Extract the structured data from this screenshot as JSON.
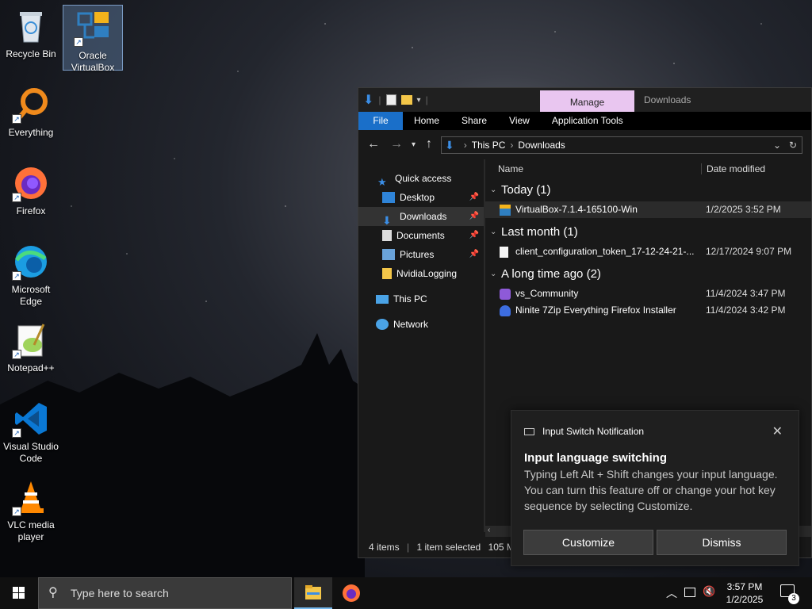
{
  "desktop": {
    "icons": [
      {
        "label": "Recycle Bin",
        "icon": "recycle-bin-icon"
      },
      {
        "label": "Oracle VirtualBox",
        "icon": "virtualbox-icon"
      },
      {
        "label": "Everything",
        "icon": "everything-search-icon"
      },
      {
        "label": "Firefox",
        "icon": "firefox-icon"
      },
      {
        "label": "Microsoft Edge",
        "icon": "edge-icon"
      },
      {
        "label": "Notepad++",
        "icon": "notepad-plus-plus-icon"
      },
      {
        "label": "Visual Studio Code",
        "icon": "vscode-icon"
      },
      {
        "label": "VLC media player",
        "icon": "vlc-icon"
      }
    ]
  },
  "explorer": {
    "context_tab": "Manage",
    "context_title": "Downloads",
    "ribbon_tabs": [
      "File",
      "Home",
      "Share",
      "View",
      "Application Tools"
    ],
    "breadcrumb": [
      "This PC",
      "Downloads"
    ],
    "nav": [
      {
        "label": "Quick access",
        "pinned": false
      },
      {
        "label": "Desktop",
        "pinned": true
      },
      {
        "label": "Downloads",
        "pinned": true
      },
      {
        "label": "Documents",
        "pinned": true
      },
      {
        "label": "Pictures",
        "pinned": true
      },
      {
        "label": "NvidiaLogging",
        "pinned": false
      },
      {
        "label": "This PC",
        "pinned": false
      },
      {
        "label": "Network",
        "pinned": false
      }
    ],
    "columns": [
      "Name",
      "Date modified"
    ],
    "groups": [
      {
        "label": "Today (1)",
        "files": [
          {
            "name": "VirtualBox-7.1.4-165100-Win",
            "date": "1/2/2025 3:52 PM",
            "icon": "virtualbox-installer-icon"
          }
        ]
      },
      {
        "label": "Last month (1)",
        "files": [
          {
            "name": "client_configuration_token_17-12-24-21-...",
            "date": "12/17/2024 9:07 PM",
            "icon": "document-icon"
          }
        ]
      },
      {
        "label": "A long time ago (2)",
        "files": [
          {
            "name": "vs_Community",
            "date": "11/4/2024 3:47 PM",
            "icon": "visual-studio-icon"
          },
          {
            "name": "Ninite 7Zip Everything Firefox Installer",
            "date": "11/4/2024 3:42 PM",
            "icon": "ninite-icon"
          }
        ]
      }
    ],
    "status": {
      "items": "4 items",
      "selected": "1 item selected",
      "size": "105 MB"
    }
  },
  "notification": {
    "app": "Input Switch Notification",
    "title": "Input language switching",
    "body": "Typing Left Alt + Shift changes your input language. You can turn this feature off or change your hot key sequence by selecting Customize.",
    "customize_label": "Customize",
    "dismiss_label": "Dismiss"
  },
  "taskbar": {
    "search_placeholder": "Type here to search",
    "time": "3:57 PM",
    "date": "1/2/2025",
    "notification_count": "3"
  }
}
